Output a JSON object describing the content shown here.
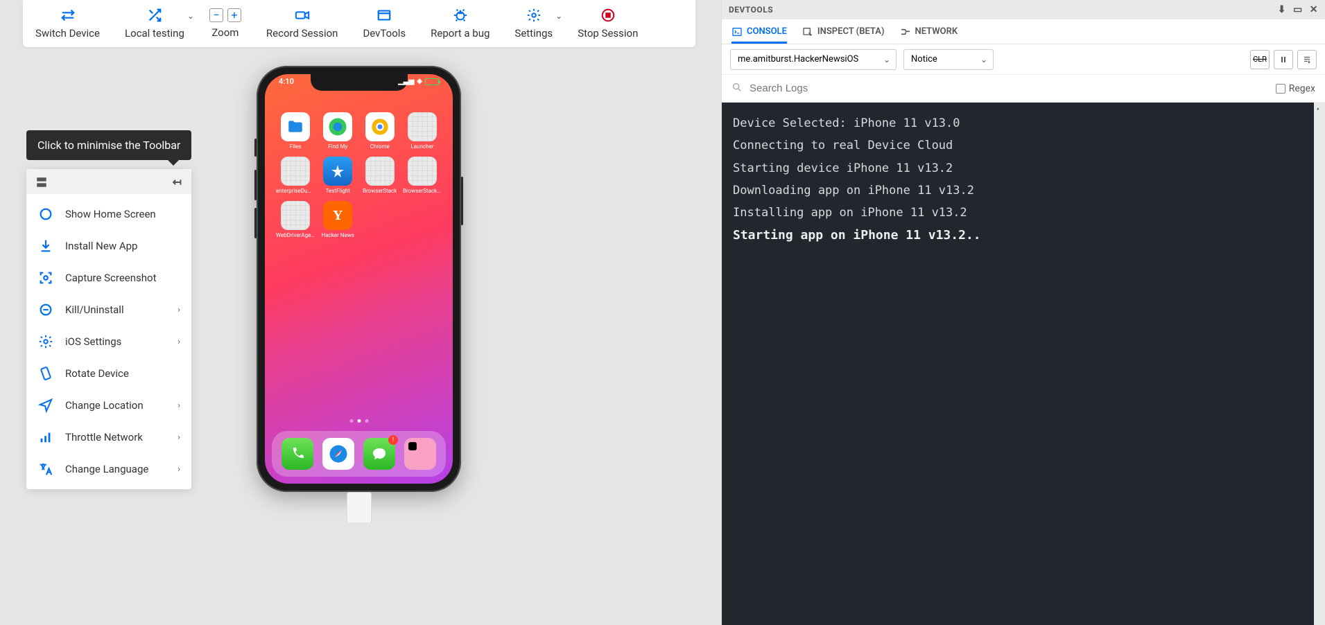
{
  "toolbar": {
    "switch_device": "Switch Device",
    "local_testing": "Local testing",
    "zoom": "Zoom",
    "record_session": "Record Session",
    "devtools": "DevTools",
    "report_bug": "Report a bug",
    "settings": "Settings",
    "stop_session": "Stop Session"
  },
  "tooltip": "Click to minimise the Toolbar",
  "sidebar": {
    "items": [
      {
        "label": "Show Home Screen",
        "chevron": false
      },
      {
        "label": "Install New App",
        "chevron": false
      },
      {
        "label": "Capture Screenshot",
        "chevron": false
      },
      {
        "label": "Kill/Uninstall",
        "chevron": true
      },
      {
        "label": "iOS Settings",
        "chevron": true
      },
      {
        "label": "Rotate Device",
        "chevron": false
      },
      {
        "label": "Change Location",
        "chevron": true
      },
      {
        "label": "Throttle Network",
        "chevron": true
      },
      {
        "label": "Change Language",
        "chevron": true
      }
    ]
  },
  "phone": {
    "time": "4:10",
    "apps_row1": [
      "Files",
      "Find My",
      "Chrome",
      "Launcher"
    ],
    "apps_row2": [
      "enterpriseDummy",
      "TestFlight",
      "BrowserStack",
      "BrowserStackUI..."
    ],
    "apps_row3": [
      "WebDriverAgen...",
      "Hacker News"
    ],
    "dock": [
      "Phone",
      "Safari",
      "Messages",
      "App"
    ]
  },
  "devtools": {
    "title": "DEVTOOLS",
    "tabs": {
      "console": "CONSOLE",
      "inspect": "INSPECT (BETA)",
      "network": "NETWORK"
    },
    "app_select": "me.amitburst.HackerNewsiOS",
    "level_select": "Notice",
    "clr": "CLR",
    "search_placeholder": "Search Logs",
    "regex_label": "Regex",
    "log_lines": [
      "Device Selected: iPhone 11 v13.0",
      "Connecting to real Device Cloud",
      "Starting device iPhone 11 v13.2",
      "Downloading app on iPhone 11 v13.2",
      "Installing app on iPhone 11 v13.2"
    ],
    "log_current": "Starting app on iPhone 11 v13.2.."
  }
}
